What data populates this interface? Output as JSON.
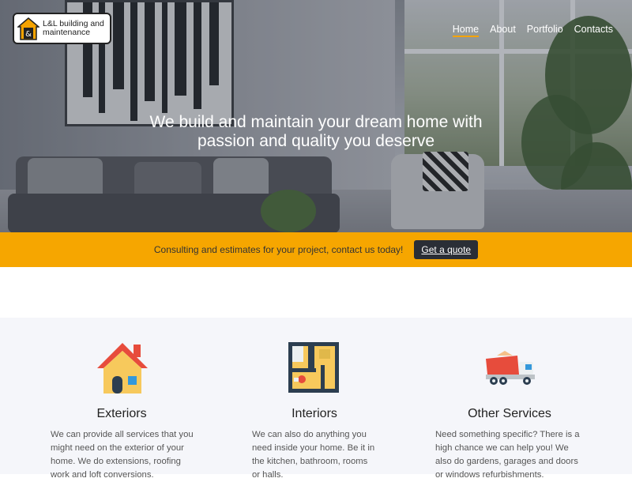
{
  "logo": {
    "line1": "L&L building and",
    "line2": "maintenance"
  },
  "nav": {
    "items": [
      "Home",
      "About",
      "Portfolio",
      "Contacts"
    ],
    "active": "Home"
  },
  "hero": {
    "line1": "We build and maintain your dream home with",
    "line2": "passion and quality you deserve"
  },
  "cta": {
    "text": "Consulting and estimates for your project, contact us today!",
    "button": "Get a quote"
  },
  "services": [
    {
      "title": "Exteriors",
      "icon": "house-icon",
      "lines": [
        "We can provide all services that you",
        "might need on the exterior of your",
        "home. We do extensions, roofing",
        "work and loft conversions."
      ]
    },
    {
      "title": "Interiors",
      "icon": "floor-plan-icon",
      "lines": [
        "We can also do anything you",
        "need inside your home. Be it in",
        "the kitchen, bathroom, rooms",
        "or halls."
      ]
    },
    {
      "title": "Other Services",
      "icon": "dump-truck-icon",
      "lines": [
        "Need something specific? There is a",
        "high chance we can help you! We",
        "also do gardens, garages and doors",
        "or windows refurbishments."
      ]
    }
  ],
  "colors": {
    "accent": "#f6a600",
    "dark_button": "#2a2e36",
    "services_bg": "#f5f6fa"
  }
}
